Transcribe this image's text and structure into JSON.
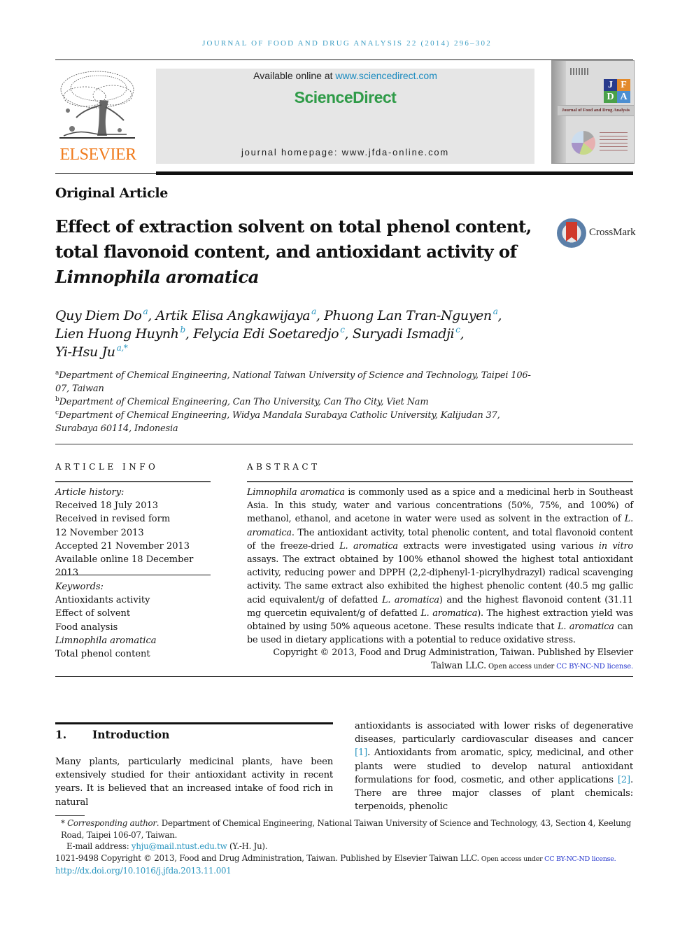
{
  "running_head": "Journal of Food and Drug Analysis 22 (2014) 296–302",
  "publisher": {
    "logo_word": "ELSEVIER",
    "logo_icon": "elsevier-tree-icon",
    "brand_color": "#f07b1d"
  },
  "banner": {
    "available_prefix": "Available online at ",
    "available_link": "www.sciencedirect.com",
    "brand": "ScienceDirect",
    "brand_color": "#2f9b48",
    "homepage": "journal homepage: www.jfda-online.com"
  },
  "cover": {
    "letters": [
      "J",
      "F",
      "D",
      "A"
    ],
    "title": "Journal of Food and Drug Analysis"
  },
  "article_type": "Original Article",
  "title": {
    "line1": "Effect of extraction solvent on total phenol content,",
    "line2": "total flavonoid content, and antioxidant activity of",
    "line3_italic": "Limnophila aromatica"
  },
  "crossmark": {
    "label": "CrossMark",
    "icon": "crossmark-icon"
  },
  "authors": [
    {
      "name": "Quy Diem Do",
      "aff": "a",
      "sep": ", "
    },
    {
      "name": "Artik Elisa Angkawijaya",
      "aff": "a",
      "sep": ", "
    },
    {
      "name": "Phuong Lan Tran-Nguyen",
      "aff": "a",
      "sep": ","
    },
    {
      "name": "Lien Huong Huynh",
      "aff": "b",
      "sep": ", "
    },
    {
      "name": "Felycia Edi Soetaredjo",
      "aff": "c",
      "sep": ", "
    },
    {
      "name": "Suryadi Ismadji",
      "aff": "c",
      "sep": ","
    },
    {
      "name": "Yi-Hsu Ju",
      "aff": "a,*",
      "sep": ""
    }
  ],
  "affiliations": [
    {
      "key": "a",
      "text": "Department of Chemical Engineering, National Taiwan University of Science and Technology, Taipei 106-07, Taiwan"
    },
    {
      "key": "b",
      "text": "Department of Chemical Engineering, Can Tho University, Can Tho City, Viet Nam"
    },
    {
      "key": "c",
      "text": "Department of Chemical Engineering, Widya Mandala Surabaya Catholic University, Kalijudan 37, Surabaya 60114, Indonesia"
    }
  ],
  "article_info": {
    "heading": "Article Info",
    "history_label": "Article history:",
    "history": [
      "Received 18 July 2013",
      "Received in revised form",
      "12 November 2013",
      "Accepted 21 November 2013",
      "Available online 18 December 2013"
    ],
    "keywords_label": "Keywords:",
    "keywords": [
      {
        "text": "Antioxidants activity",
        "italic": false
      },
      {
        "text": "Effect of solvent",
        "italic": false
      },
      {
        "text": "Food analysis",
        "italic": false
      },
      {
        "text": "Limnophila aromatica",
        "italic": true
      },
      {
        "text": "Total phenol content",
        "italic": false
      }
    ]
  },
  "abstract": {
    "heading": "Abstract",
    "p1_i": "Limnophila aromatica",
    "p1": " is commonly used as a spice and a medicinal herb in Southeast Asia. In this study, water and various concentrations (50%, 75%, and 100%) of methanol, ethanol, and acetone in water were used as solvent in the extraction of ",
    "p2_i": "L. aromatica",
    "p2": ". The antioxidant activity, total phenolic content, and total flavonoid content of the freeze-dried ",
    "p3_i": "L. aromatica",
    "p3": " extracts were investigated using various ",
    "p4_i": "in vitro",
    "p4": " assays. The extract obtained by 100% ethanol showed the highest total antioxidant activity, reducing power and DPPH (2,2-diphenyl-1-picrylhydrazyl) radical scavenging activity. The same extract also exhibited the highest phenolic content (40.5 mg gallic acid equivalent/g of defatted ",
    "p5_i": "L. aromatica",
    "p5": ") and the highest flavonoid content (31.11 mg quercetin equivalent/g of defatted ",
    "p6_i": "L. aromatica",
    "p6": "). The highest extraction yield was obtained by using 50% aqueous acetone. These results indicate that ",
    "p7_i": "L. aromatica",
    "p7": " can be used in dietary applications with a potential to reduce oxidative stress.",
    "copyright": "Copyright © 2013, Food and Drug Administration, Taiwan. Published by Elsevier Taiwan LLC.",
    "open_access": " Open access under ",
    "license_link": "CC BY-NC-ND license."
  },
  "intro": {
    "number": "1.",
    "heading": "Introduction",
    "col1": "Many plants, particularly medicinal plants, have been extensively studied for their antioxidant activity in recent years. It is believed that an increased intake of food rich in natural",
    "col2_a": "antioxidants is associated with lower risks of degenerative diseases, particularly cardiovascular diseases and cancer ",
    "ref1": "[1]",
    "col2_b": ". Antioxidants from aromatic, spicy, medicinal, and other plants were studied to develop natural antioxidant formulations for food, cosmetic, and other applications ",
    "ref2": "[2]",
    "col2_c": ". There are three major classes of plant chemicals: terpenoids, phenolic"
  },
  "footnotes": {
    "star": "* ",
    "corr_label": "Corresponding author",
    "corr_text": ". Department of Chemical Engineering, National Taiwan University of Science and Technology, 43, Section 4, Keelung Road, Taipei 106-07, Taiwan.",
    "email_label": "E-mail address: ",
    "email": "yhju@mail.ntust.edu.tw",
    "email_suffix": " (Y.-H. Ju).",
    "issn_copy": "1021-9498 Copyright © 2013, Food and Drug Administration, Taiwan. Published by Elsevier Taiwan LLC.",
    "open_access": " Open access under ",
    "license_link": "CC BY-NC-ND license.",
    "doi": "http://dx.doi.org/10.1016/j.jfda.2013.11.001"
  }
}
